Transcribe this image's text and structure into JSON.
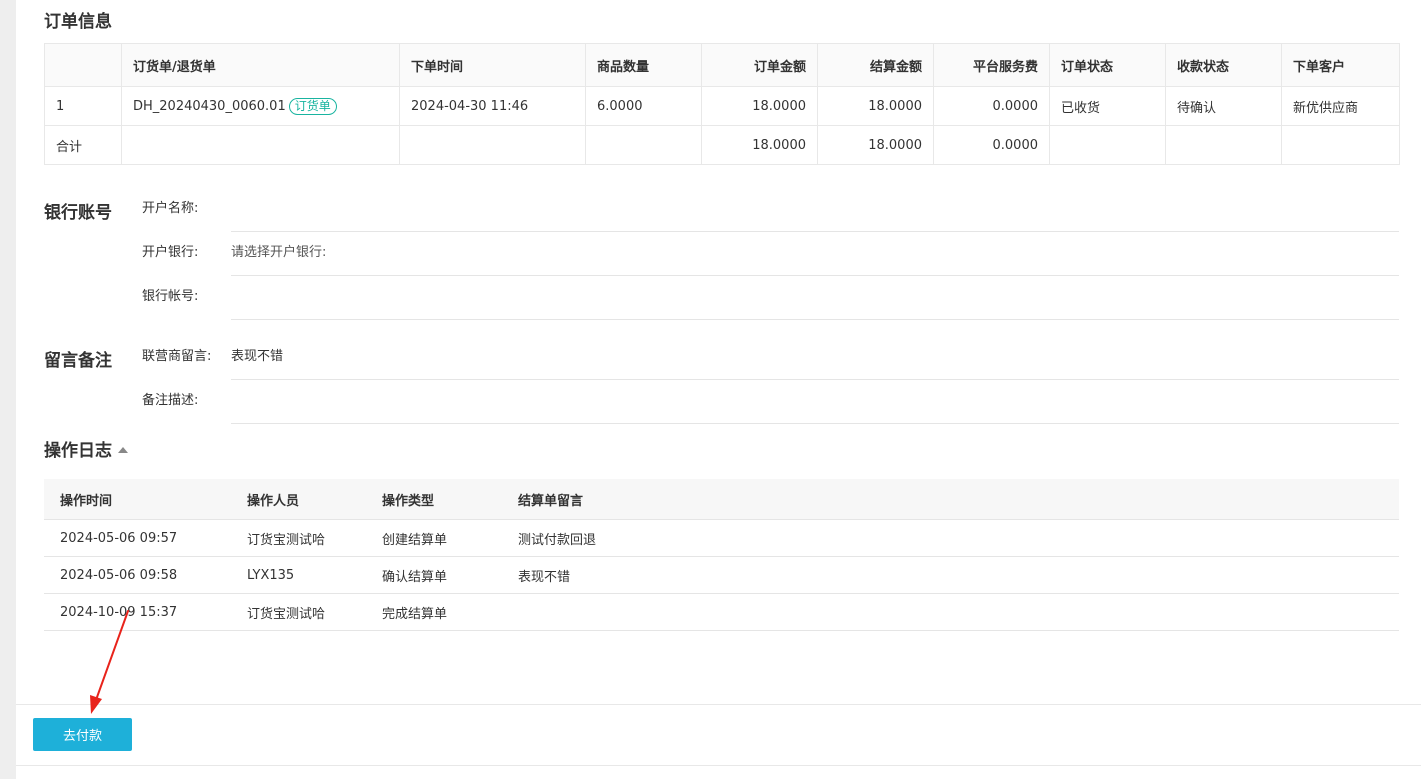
{
  "order_info": {
    "title": "订单信息",
    "headers": [
      "",
      "订货单/退货单",
      "下单时间",
      "商品数量",
      "订单金额",
      "结算金额",
      "平台服务费",
      "订单状态",
      "收款状态",
      "下单客户"
    ],
    "rows": [
      {
        "index": "1",
        "order_no": "DH_20240430_0060.01",
        "tag": "订货单",
        "time": "2024-04-30 11:46",
        "qty": "6.0000",
        "order_amount": "18.0000",
        "settle_amount": "18.0000",
        "service_fee": "0.0000",
        "order_status": "已收货",
        "payment_status": "待确认",
        "customer": "新优供应商"
      }
    ],
    "total": {
      "label": "合计",
      "order_amount": "18.0000",
      "settle_amount": "18.0000",
      "service_fee": "0.0000"
    }
  },
  "bank": {
    "title": "银行账号",
    "account_name_label": "开户名称:",
    "account_name_value": "",
    "bank_label": "开户银行:",
    "bank_value": "请选择开户银行:",
    "account_no_label": "银行帐号:",
    "account_no_value": ""
  },
  "remarks": {
    "title": "留言备注",
    "message_label": "联营商留言:",
    "message_value": "表现不错",
    "desc_label": "备注描述:",
    "desc_value": ""
  },
  "log": {
    "title": "操作日志",
    "headers": [
      "操作时间",
      "操作人员",
      "操作类型",
      "结算单留言"
    ],
    "rows": [
      {
        "time": "2024-05-06 09:57",
        "operator": "订货宝测试哈",
        "type": "创建结算单",
        "message": "测试付款回退"
      },
      {
        "time": "2024-05-06 09:58",
        "operator": "LYX135",
        "type": "确认结算单",
        "message": "表现不错"
      },
      {
        "time": "2024-10-09 15:37",
        "operator": "订货宝测试哈",
        "type": "完成结算单",
        "message": ""
      }
    ]
  },
  "footer": {
    "pay_button": "去付款"
  },
  "colors": {
    "accent": "#1eb0d9",
    "tag": "#19b4a0",
    "annotation": "#e8231b"
  }
}
